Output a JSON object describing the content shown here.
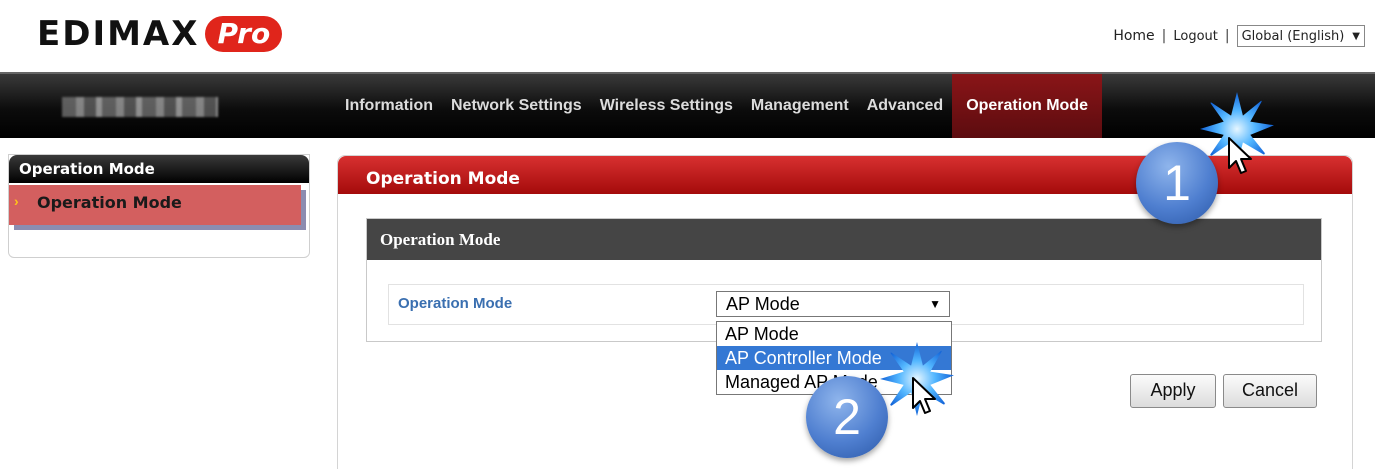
{
  "logo": {
    "brand": "EDIMAX",
    "pro": "Pro"
  },
  "toplinks": {
    "home": "Home",
    "sep1": "|",
    "logout": "Logout",
    "sep2": "|",
    "language": "Global (English)",
    "language_arrow": "▼"
  },
  "nav": {
    "items": [
      "Information",
      "Network Settings",
      "Wireless Settings",
      "Management",
      "Advanced",
      "Operation Mode"
    ],
    "active": "Operation Mode"
  },
  "sidebar": {
    "title": "Operation Mode",
    "items": [
      {
        "label": "Operation Mode",
        "chevron": "›"
      }
    ]
  },
  "panel": {
    "title": "Operation Mode",
    "section_title": "Operation Mode",
    "field_label": "Operation Mode",
    "select_value": "AP Mode",
    "select_arrow": "▼",
    "options": [
      "AP Mode",
      "AP Controller Mode",
      "Managed AP Mode"
    ],
    "highlighted_option": "AP Controller Mode",
    "apply_label": "Apply",
    "cancel_label": "Cancel"
  },
  "annotations": {
    "step1": "1",
    "step2": "2"
  },
  "colors": {
    "accent_red": "#c01818",
    "nav_black": "#000000",
    "link_blue": "#3a6fb0",
    "highlight_blue": "#3478d4",
    "badge_blue": "#4f7fd0"
  }
}
